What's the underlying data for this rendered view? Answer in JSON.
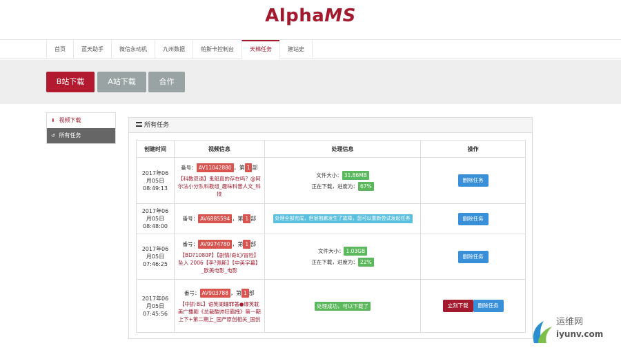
{
  "logo": {
    "alpha": "Alpha",
    "ms": "MS"
  },
  "nav": [
    {
      "label": "首页"
    },
    {
      "label": "蓝天助手"
    },
    {
      "label": "微信永动机"
    },
    {
      "label": "九州数据"
    },
    {
      "label": "帕斯卡控制台"
    },
    {
      "label": "天梯任务",
      "active": true
    },
    {
      "label": "建站史"
    }
  ],
  "hero": {
    "btn_b": "B站下载",
    "btn_a": "A站下载",
    "btn_c": "合作"
  },
  "sidebar": [
    {
      "label": "视频下载",
      "icon": "download-icon"
    },
    {
      "label": "所有任务",
      "icon": "history-icon",
      "active": true
    }
  ],
  "panel": {
    "title": "所有任务"
  },
  "table": {
    "headers": [
      "创建时间",
      "视频信息",
      "处理信息",
      "操作"
    ],
    "labels": {
      "number": "番号：",
      "part_pre": "第",
      "part_post": "部",
      "size": "文件大小：",
      "progress": "正在下载，进度为："
    },
    "rows": [
      {
        "date": "2017年06月05日",
        "time": "08:49:13",
        "av": "AV11042880",
        "part": "1",
        "title": "【科教双语】鬼船真的存在吗？@阿尔法小分队科教组_趣味科普人文_科技",
        "size": "31.86MB",
        "progress": "67%",
        "delete": "删除任务"
      },
      {
        "date": "2017年06月05日",
        "time": "08:48:00",
        "av": "AV6885594",
        "part": "1",
        "title": "",
        "status": "处理全部完成，但很抱歉发生了故障，您可以重新尝试发起任务",
        "delete": "删除任务"
      },
      {
        "date": "2017年06月05日",
        "time": "07:46:25",
        "av": "AV9974780",
        "part": "1",
        "title": "【BD?1080P】【剧情/奇幻/冒险】坠入 2006【李?佩斯】【中英字幕】_欧美电影_电影",
        "size": "1.03GB",
        "progress": "22%",
        "delete": "删除任务"
      },
      {
        "date": "2017年06月05日",
        "time": "07:45:56",
        "av": "AV903788",
        "part": "1",
        "title": "【中抓·BL】语笑阑珊罪著●爆笑耽美广播剧《总裁酷帅狂霸拽》第一期上下+第二期上_国产原创相关_国创",
        "status": "处理成功，可以下载了",
        "download": "立刻下载",
        "delete": "删除任务"
      }
    ]
  },
  "watermark": {
    "cn": "运维网",
    "en": "iyunv.com"
  }
}
